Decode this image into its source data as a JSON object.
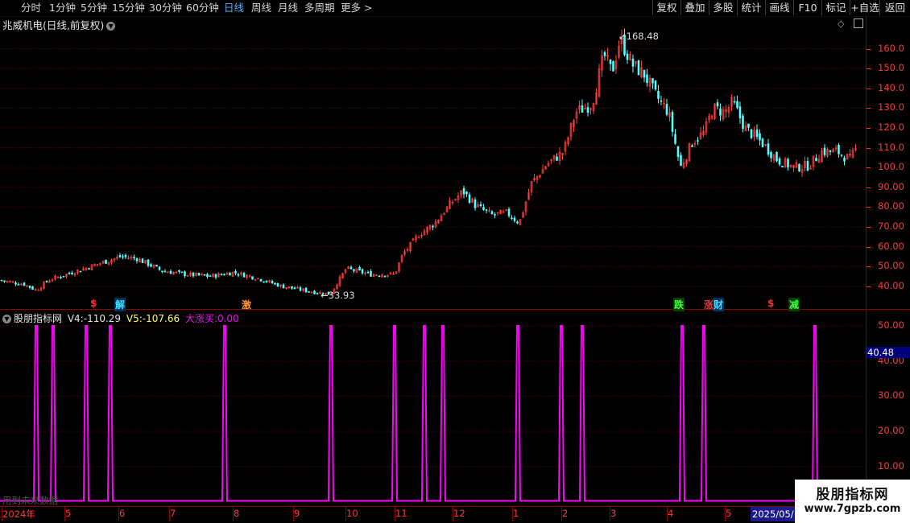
{
  "toolbar": {
    "periods": [
      "分时",
      "1分钟",
      "5分钟",
      "15分钟",
      "30分钟",
      "60分钟",
      "日线",
      "周线",
      "月线",
      "多周期",
      "更多 >"
    ],
    "active_period": "日线",
    "right_buttons": [
      "复权",
      "叠加",
      "多股",
      "统计",
      "画线",
      "F10",
      "标记",
      "+自选",
      "返回"
    ]
  },
  "main_chart": {
    "title": "兆威机电(日线,前复权)",
    "high_label": "168.48",
    "low_label": "33.93",
    "y_ticks": [
      "160.0",
      "150.0",
      "140.0",
      "130.0",
      "120.0",
      "110.0",
      "100.0",
      "90.00",
      "80.00",
      "70.00",
      "60.00",
      "50.00",
      "40.00"
    ],
    "signals": [
      {
        "text": "$",
        "color": "#ff3030"
      },
      {
        "text": "解",
        "color": "#40e0ff"
      },
      {
        "text": "激",
        "color": "#ff9a3a"
      },
      {
        "text": "跌",
        "color": "#40ff40"
      },
      {
        "text": "涨",
        "color": "#ff3030"
      },
      {
        "text": "财",
        "color": "#40e0ff"
      },
      {
        "text": "$",
        "color": "#ff3030"
      },
      {
        "text": "减",
        "color": "#40ff40"
      }
    ]
  },
  "indicator": {
    "name": "股朋指标网",
    "v4_label": "V4:",
    "v4_value": "-110.29",
    "v5_label": "V5:",
    "v5_value": "-107.66",
    "buy_label": "大涨买:",
    "buy_value": "0.00",
    "y_ticks": [
      "50.00",
      "40.00",
      "30.00",
      "20.00",
      "10.00"
    ],
    "current_value": "40.48",
    "note": "用到未来数据"
  },
  "date_axis": [
    "2024年",
    "5",
    "6",
    "7",
    "8",
    "9",
    "10",
    "11",
    "12",
    "1",
    "2",
    "3",
    "4",
    "5"
  ],
  "date_highlight": "2025/05/",
  "watermark": {
    "title": "股朋指标网",
    "url": "www.7gpzb.com"
  },
  "colors": {
    "up": "#ff3c3c",
    "down": "#54ffff",
    "indicator": "#ff00ff",
    "grid": "#7a0000",
    "axis": "#ff3030"
  }
}
